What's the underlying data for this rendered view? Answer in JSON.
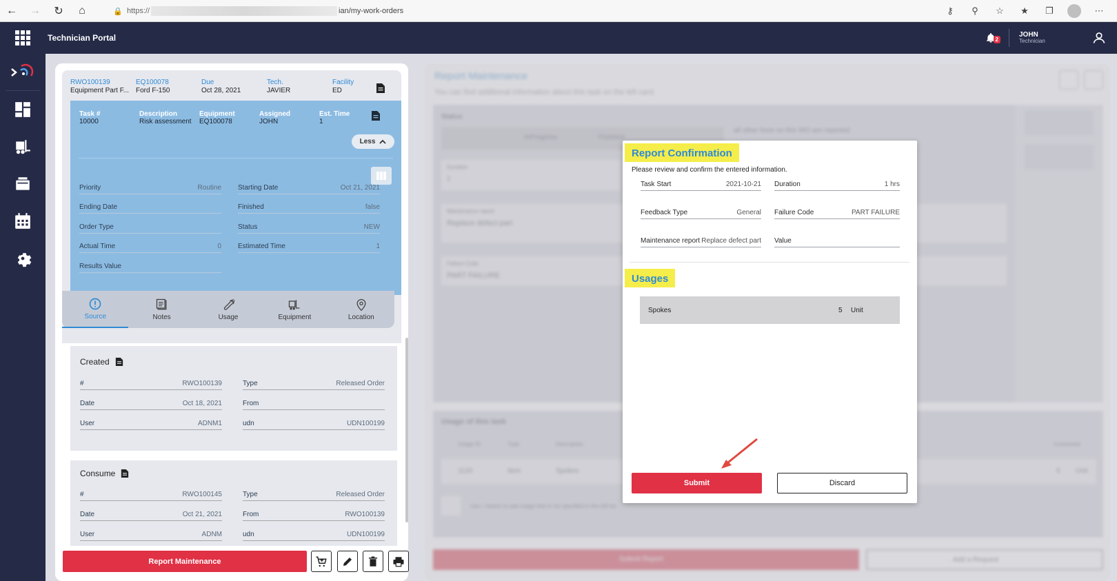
{
  "browser": {
    "url_prefix": "https://",
    "url_suffix": "ian/my-work-orders"
  },
  "header": {
    "app_title": "Technician Portal",
    "notification_count": "2",
    "user_name": "JOHN",
    "user_role": "Technician"
  },
  "work_order": {
    "id_label": "RWO100139",
    "id_value": "Equipment Part F...",
    "equipment_label": "EQ100078",
    "equipment_value": "Ford F-150",
    "due_label": "Due",
    "due_value": "Oct 28, 2021",
    "tech_label": "Tech.",
    "tech_value": "JAVIER",
    "facility_label": "Facility",
    "facility_value": "ED"
  },
  "task": {
    "headers": [
      {
        "label": "Task #",
        "value": "10000"
      },
      {
        "label": "Description",
        "value": "Risk assessment"
      },
      {
        "label": "Equipment",
        "value": "EQ100078"
      },
      {
        "label": "Assigned",
        "value": "JOHN"
      },
      {
        "label": "Est. Time",
        "value": "1"
      }
    ],
    "less_label": "Less",
    "fields": [
      {
        "label": "Priority",
        "value": "Routine"
      },
      {
        "label": "Starting Date",
        "value": "Oct 21, 2021"
      },
      {
        "label": "Ending Date",
        "value": ""
      },
      {
        "label": "Finished",
        "value": "false"
      },
      {
        "label": "Order Type",
        "value": ""
      },
      {
        "label": "Status",
        "value": "NEW"
      },
      {
        "label": "Actual Time",
        "value": "0"
      },
      {
        "label": "Estimated Time",
        "value": "1"
      },
      {
        "label": "Results Value",
        "value": ""
      }
    ]
  },
  "tabs": [
    {
      "label": "Source",
      "icon": "alert-circle-icon"
    },
    {
      "label": "Notes",
      "icon": "notes-icon"
    },
    {
      "label": "Usage",
      "icon": "wrench-icon"
    },
    {
      "label": "Equipment",
      "icon": "forklift-icon"
    },
    {
      "label": "Location",
      "icon": "location-pin-icon"
    }
  ],
  "created": {
    "title": "Created",
    "fields": [
      {
        "label": "#",
        "value": "RWO100139"
      },
      {
        "label": "Type",
        "value": "Released Order"
      },
      {
        "label": "Date",
        "value": "Oct 18, 2021"
      },
      {
        "label": "From",
        "value": ""
      },
      {
        "label": "User",
        "value": "ADNM1"
      },
      {
        "label": "udn",
        "value": "UDN100199"
      }
    ]
  },
  "consume": {
    "title": "Consume",
    "fields": [
      {
        "label": "#",
        "value": "RWO100145"
      },
      {
        "label": "Type",
        "value": "Released Order"
      },
      {
        "label": "Date",
        "value": "Oct 21, 2021"
      },
      {
        "label": "From",
        "value": "RWO100139"
      },
      {
        "label": "User",
        "value": "ADNM"
      },
      {
        "label": "udn",
        "value": "UDN100199"
      }
    ]
  },
  "actions": {
    "report_maintenance": "Report Maintenance"
  },
  "background": {
    "title": "Report Maintenance",
    "subtitle": "You can find additional information about this task on the left card.",
    "status_label": "Status",
    "in_progress": "InProgress",
    "finished": "Finished",
    "all_other_lines": "all other lines on this WO are reported",
    "duration_label": "Duration",
    "duration_value": "1",
    "maintenance_report_label": "Maintenance report",
    "maintenance_report_value": "Replace defect part",
    "failure_code_label": "Failure Code",
    "failure_code_value": "PART FAILURE",
    "usage_title": "Usage of this task",
    "col_usage_id": "Usage ID",
    "col_type": "Type",
    "col_description": "Description",
    "col_consumed": "Consumed",
    "row_id": "1120",
    "row_type": "Item",
    "row_desc": "Spokes",
    "row_qty": "5",
    "row_unit": "Unit",
    "add_hint": "Use + button to add usage that is not specified in the left list",
    "submit_report": "Submit Report",
    "add_request": "Add a Request"
  },
  "modal": {
    "title": "Report Confirmation",
    "description": "Please review and confirm the entered information.",
    "fields": [
      {
        "label": "Task Start",
        "value": "2021-10-21"
      },
      {
        "label": "Duration",
        "value": "1 hrs"
      },
      {
        "label": "Feedback Type",
        "value": "General"
      },
      {
        "label": "Failure Code",
        "value": "PART FAILURE"
      },
      {
        "label": "Maintenance report",
        "value": "Replace defect part"
      },
      {
        "label": "Value",
        "value": ""
      }
    ],
    "usages_title": "Usages",
    "usage": {
      "name": "Spokes",
      "qty": "5",
      "unit": "Unit"
    },
    "submit_label": "Submit",
    "discard_label": "Discard"
  },
  "colors": {
    "accent_blue": "#2f8ad6",
    "primary_red": "#e03145",
    "nav_dark": "#252a47",
    "highlight_yellow": "#f5ed4a"
  }
}
